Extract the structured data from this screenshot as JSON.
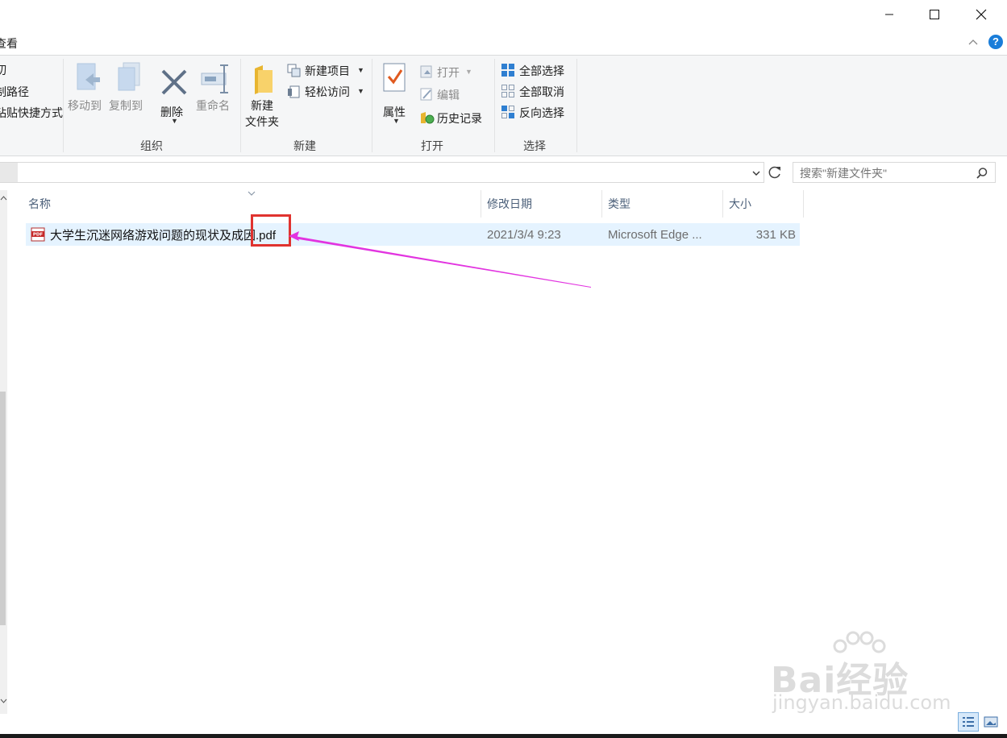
{
  "window": {
    "minimize_icon": "minimize-icon",
    "maximize_icon": "maximize-icon",
    "close_icon": "close-icon"
  },
  "ribbon_tab": {
    "label": "查看"
  },
  "help": {
    "label": "?",
    "collapse_icon": "chevron-up-icon"
  },
  "ribbon": {
    "clipboard_partial": [
      "切",
      "制路径",
      "粘贴快捷方式"
    ],
    "organize": {
      "label": "组织",
      "move_to": "移动到",
      "copy_to": "复制到",
      "delete": "删除",
      "rename": "重命名"
    },
    "new": {
      "label": "新建",
      "new_folder_line1": "新建",
      "new_folder_line2": "文件夹",
      "new_item": "新建项目",
      "easy_access": "轻松访问"
    },
    "open": {
      "label": "打开",
      "properties": "属性",
      "open": "打开",
      "edit": "编辑",
      "history": "历史记录"
    },
    "select": {
      "label": "选择",
      "select_all": "全部选择",
      "select_none": "全部取消",
      "invert": "反向选择"
    }
  },
  "address": {
    "path": ""
  },
  "search": {
    "placeholder": "搜索\"新建文件夹\""
  },
  "columns": [
    "名称",
    "修改日期",
    "类型",
    "大小"
  ],
  "files": [
    {
      "name": "大学生沉迷网络游戏问题的现状及成因.pdf",
      "date": "2021/3/4 9:23",
      "type": "Microsoft Edge ...",
      "size": "331 KB",
      "icon": "pdf-icon"
    }
  ],
  "watermark": {
    "brand": "Bai经验",
    "url": "jingyan.baidu.com"
  },
  "colors": {
    "selection": "#e5f3ff",
    "annotation_box": "#e0332f",
    "annotation_arrow": "#e234e0",
    "accent": "#1a7dd9"
  }
}
